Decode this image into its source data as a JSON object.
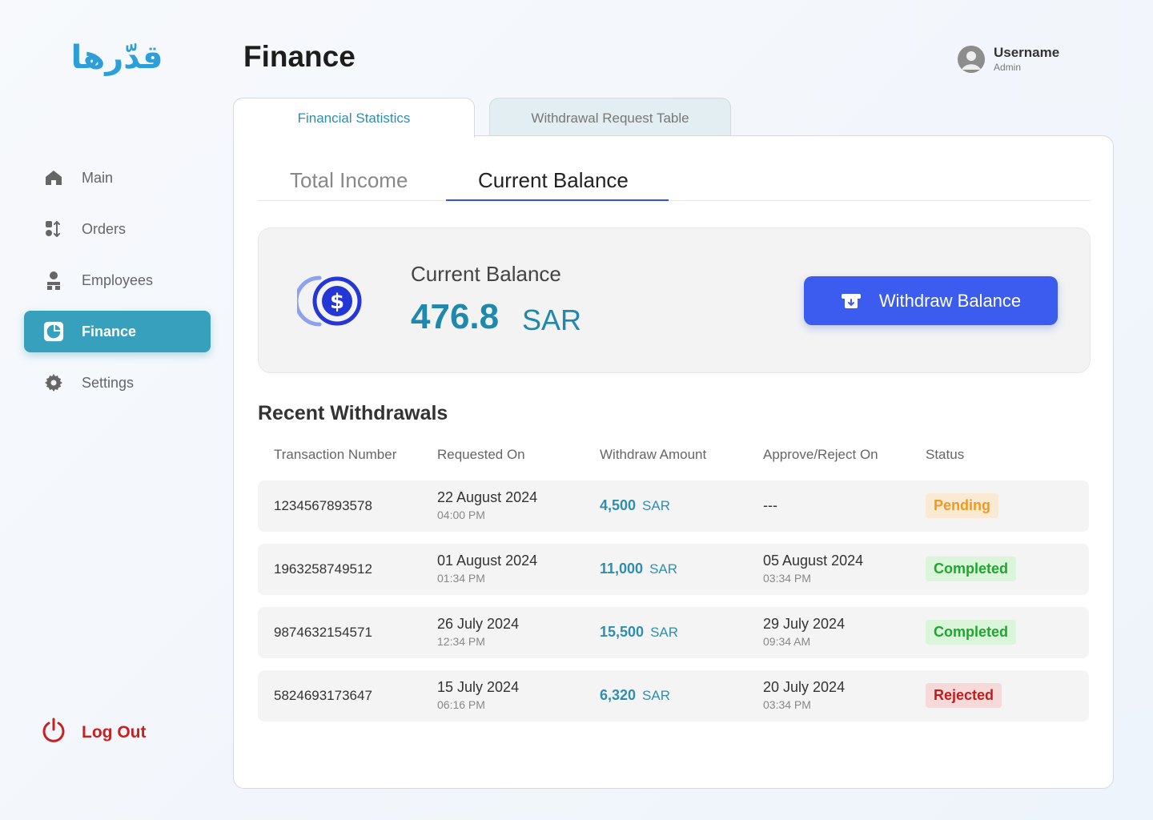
{
  "logo_text": "قدّرها",
  "page_title": "Finance",
  "user": {
    "name": "Username",
    "role": "Admin"
  },
  "sidebar": {
    "items": [
      {
        "label": "Main",
        "icon": "home-icon"
      },
      {
        "label": "Orders",
        "icon": "orders-icon"
      },
      {
        "label": "Employees",
        "icon": "employees-icon"
      },
      {
        "label": "Finance",
        "icon": "finance-icon",
        "active": true
      },
      {
        "label": "Settings",
        "icon": "gear-icon"
      }
    ],
    "logout_label": "Log Out"
  },
  "tabs": {
    "financial_statistics": "Financial Statistics",
    "withdrawal_request_table": "Withdrawal Request Table"
  },
  "subtabs": {
    "total_income": "Total Income",
    "current_balance": "Current Balance"
  },
  "balance": {
    "label": "Current Balance",
    "amount": "476.8",
    "currency": "SAR",
    "withdraw_button": "Withdraw Balance"
  },
  "recent": {
    "title": "Recent Withdrawals",
    "columns": [
      "Transaction Number",
      "Requested On",
      "Withdraw Amount",
      "Approve/Reject On",
      "Status"
    ],
    "rows": [
      {
        "txn": "1234567893578",
        "req_date": "22 August 2024",
        "req_time": "04:00 PM",
        "amount": "4,500",
        "currency": "SAR",
        "approve_date": "---",
        "approve_time": "",
        "status": "Pending"
      },
      {
        "txn": "1963258749512",
        "req_date": "01 August 2024",
        "req_time": "01:34 PM",
        "amount": "11,000",
        "currency": "SAR",
        "approve_date": "05 August 2024",
        "approve_time": "03:34 PM",
        "status": "Completed"
      },
      {
        "txn": "9874632154571",
        "req_date": "26 July 2024",
        "req_time": "12:34 PM",
        "amount": "15,500",
        "currency": "SAR",
        "approve_date": "29 July 2024",
        "approve_time": "09:34 AM",
        "status": "Completed"
      },
      {
        "txn": "5824693173647",
        "req_date": "15 July 2024",
        "req_time": "06:16 PM",
        "amount": "6,320",
        "currency": "SAR",
        "approve_date": "20 July 2024",
        "approve_time": "03:34 PM",
        "status": "Rejected"
      }
    ]
  },
  "colors": {
    "accent": "#36a0bd",
    "primary_button": "#3c5cf0",
    "amount_text": "#1f88ad",
    "pending": "#ef9a1f",
    "completed": "#1fa62e",
    "rejected": "#c01d1d",
    "logout": "#c81f1f"
  }
}
